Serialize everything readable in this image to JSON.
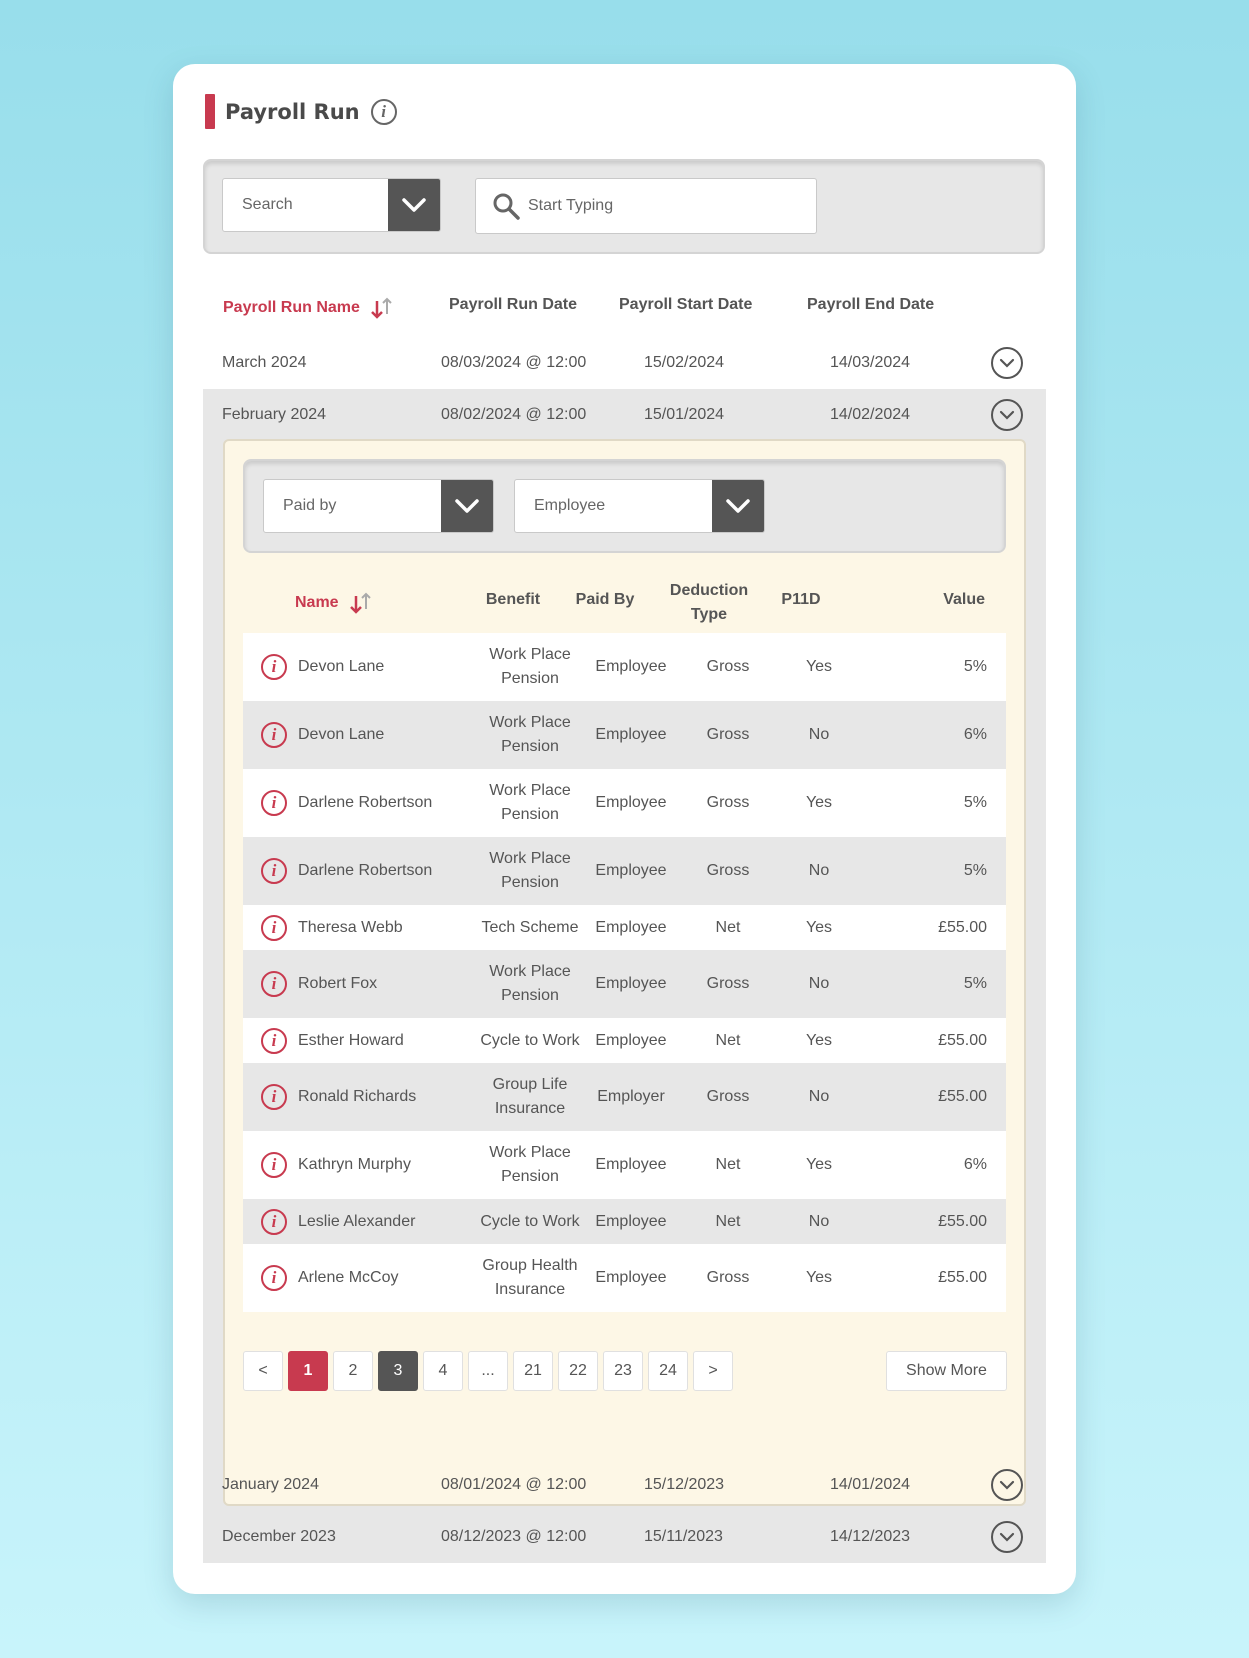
{
  "header": {
    "title": "Payroll Run"
  },
  "filter": {
    "select_label": "Search",
    "search_placeholder": "Start Typing"
  },
  "columns": {
    "name": "Payroll Run Name",
    "run_date": "Payroll Run Date",
    "start_date": "Payroll Start Date",
    "end_date": "Payroll End Date"
  },
  "runs": [
    {
      "name": "March 2024",
      "run_date": "08/03/2024 @ 12:00",
      "start": "15/02/2024",
      "end": "14/03/2024"
    },
    {
      "name": "February 2024",
      "run_date": "08/02/2024 @ 12:00",
      "start": "15/01/2024",
      "end": "14/02/2024"
    },
    {
      "name": "January 2024",
      "run_date": "08/01/2024 @ 12:00",
      "start": "15/12/2023",
      "end": "14/01/2024"
    },
    {
      "name": "December 2023",
      "run_date": "08/12/2023 @ 12:00",
      "start": "15/11/2023",
      "end": "14/12/2023"
    }
  ],
  "detail": {
    "filters": {
      "paid_by": "Paid by",
      "employee": "Employee"
    },
    "columns": {
      "name": "Name",
      "benefit": "Benefit",
      "paid_by": "Paid By",
      "deduction_type": "Deduction Type",
      "p11d": "P11D",
      "value": "Value"
    },
    "rows": [
      {
        "name": "Devon Lane",
        "benefit": "Work Place Pension",
        "paid_by": "Employee",
        "deduction": "Gross",
        "p11d": "Yes",
        "value": "5%"
      },
      {
        "name": "Devon Lane",
        "benefit": "Work Place Pension",
        "paid_by": "Employee",
        "deduction": "Gross",
        "p11d": "No",
        "value": "6%"
      },
      {
        "name": "Darlene Robertson",
        "benefit": "Work Place Pension",
        "paid_by": "Employee",
        "deduction": "Gross",
        "p11d": "Yes",
        "value": "5%"
      },
      {
        "name": "Darlene Robertson",
        "benefit": "Work Place Pension",
        "paid_by": "Employee",
        "deduction": "Gross",
        "p11d": "No",
        "value": "5%"
      },
      {
        "name": "Theresa Webb",
        "benefit": "Tech Scheme",
        "paid_by": "Employee",
        "deduction": "Net",
        "p11d": "Yes",
        "value": "£55.00"
      },
      {
        "name": "Robert Fox",
        "benefit": "Work Place Pension",
        "paid_by": "Employee",
        "deduction": "Gross",
        "p11d": "No",
        "value": "5%"
      },
      {
        "name": "Esther Howard",
        "benefit": "Cycle to Work",
        "paid_by": "Employee",
        "deduction": "Net",
        "p11d": "Yes",
        "value": "£55.00"
      },
      {
        "name": "Ronald Richards",
        "benefit": "Group Life Insurance",
        "paid_by": "Employer",
        "deduction": "Gross",
        "p11d": "No",
        "value": "£55.00"
      },
      {
        "name": "Kathryn Murphy",
        "benefit": "Work Place Pension",
        "paid_by": "Employee",
        "deduction": "Net",
        "p11d": "Yes",
        "value": "6%"
      },
      {
        "name": "Leslie Alexander",
        "benefit": "Cycle to Work",
        "paid_by": "Employee",
        "deduction": "Net",
        "p11d": "No",
        "value": "£55.00"
      },
      {
        "name": "Arlene McCoy",
        "benefit": "Group Health Insurance",
        "paid_by": "Employee",
        "deduction": "Gross",
        "p11d": "Yes",
        "value": "£55.00"
      }
    ],
    "pagination": {
      "prev": "<",
      "pages": [
        "1",
        "2",
        "3",
        "4",
        "...",
        "21",
        "22",
        "23",
        "24"
      ],
      "next": ">",
      "current": "1",
      "highlighted": "3"
    },
    "show_more": "Show More"
  },
  "colors": {
    "accent": "#c83a4f",
    "dark": "#555555",
    "row_grey": "#e7e7e7",
    "detail_bg": "#fdf7e6"
  }
}
